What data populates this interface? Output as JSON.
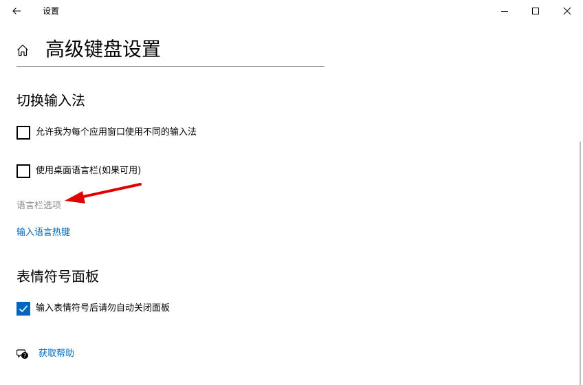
{
  "titlebar": {
    "app_title": "设置",
    "back_icon": "arrow-left-icon",
    "minimize_icon": "minimize-icon",
    "maximize_icon": "maximize-icon",
    "close_icon": "close-icon"
  },
  "header": {
    "home_icon": "home-icon",
    "title": "高级键盘设置"
  },
  "switch_input": {
    "heading": "切换输入法",
    "per_app_checkbox": {
      "label": "允许我为每个应用窗口使用不同的输入法",
      "checked": false
    },
    "desktop_langbar_checkbox": {
      "label": "使用桌面语言栏(如果可用)",
      "checked": false
    },
    "langbar_options_label": "语言栏选项",
    "hotkeys_link": "输入语言热键"
  },
  "emoji_panel": {
    "heading": "表情符号面板",
    "auto_close_checkbox": {
      "label": "输入表情符号后请勿自动关闭面板",
      "checked": true
    }
  },
  "help": {
    "icon": "help-chat-icon",
    "link": "获取帮助"
  },
  "colors": {
    "accent": "#0067c0",
    "link": "#0067b8",
    "muted": "#8a8a8a",
    "annotation_arrow": "#e00000"
  }
}
